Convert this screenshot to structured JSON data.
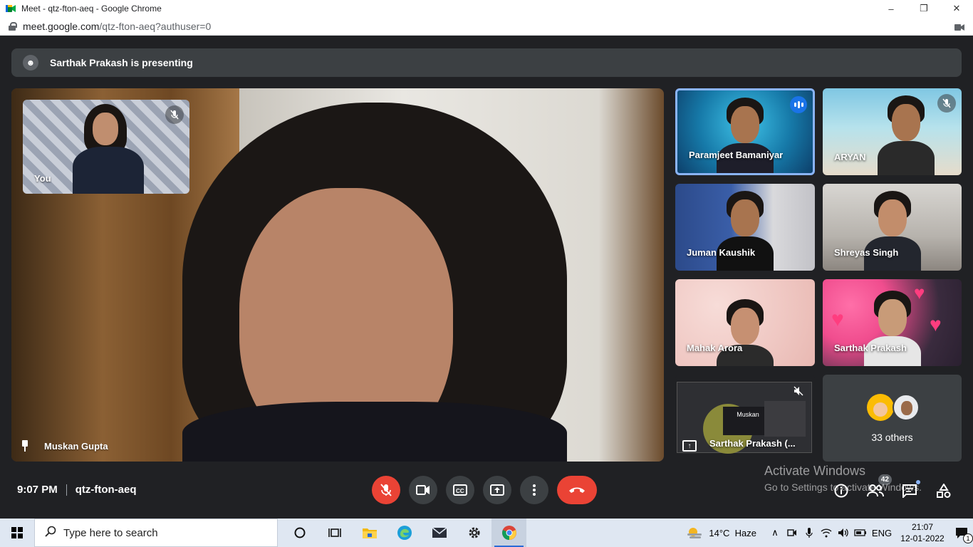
{
  "window": {
    "title": "Meet - qtz-fton-aeq - Google Chrome",
    "url_host": "meet.google.com",
    "url_path": "/qtz-fton-aeq?authuser=0"
  },
  "banner": {
    "text": "Sarthak Prakash is presenting"
  },
  "main": {
    "name": "Muskan Gupta"
  },
  "self": {
    "label": "You"
  },
  "grid": [
    {
      "name": "Paramjeet Bamaniyar",
      "state": "speaking"
    },
    {
      "name": "ARYAN",
      "state": "muted"
    },
    {
      "name": "Juman Kaushik"
    },
    {
      "name": "Shreyas Singh"
    },
    {
      "name": "Mahak Arora"
    },
    {
      "name": "Sarthak Prakash"
    },
    {
      "name": "Sarthak Prakash (...",
      "state": "presentation"
    }
  ],
  "others": {
    "label": "33 others"
  },
  "presentation_preview": {
    "text": "Muskan"
  },
  "bottom": {
    "time": "9:07 PM",
    "code": "qtz-fton-aeq",
    "participants_count": "42"
  },
  "watermark": {
    "line1": "Activate Windows",
    "line2": "Go to Settings to activate Windows."
  },
  "taskbar": {
    "search_placeholder": "Type here to search",
    "weather": "14°C  Haze",
    "lang": "ENG",
    "time": "21:07",
    "date": "12-01-2022",
    "notifications": "1"
  },
  "colors": {
    "accent_blue": "#8ab4f8",
    "leave_red": "#ea4335",
    "surface": "#3c4043",
    "background": "#202124"
  }
}
